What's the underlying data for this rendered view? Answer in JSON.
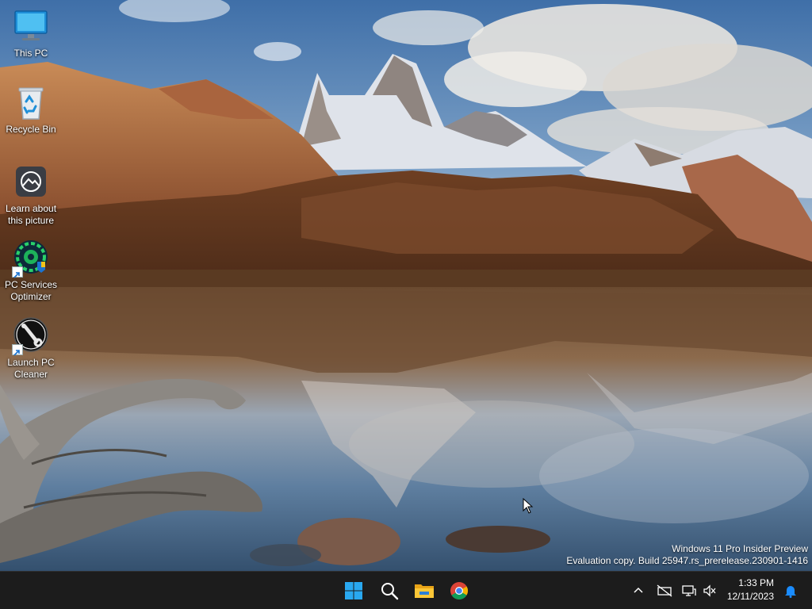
{
  "desktop": {
    "icons": [
      {
        "label": "This PC",
        "icon": "monitor-icon"
      },
      {
        "label": "Recycle Bin",
        "icon": "recycle-bin-icon"
      },
      {
        "label": "Learn about\nthis picture",
        "icon": "camera-icon"
      },
      {
        "label": "PC Services\nOptimizer",
        "icon": "gear-shield-icon"
      },
      {
        "label": "Launch PC\nCleaner",
        "icon": "wrench-icon"
      }
    ]
  },
  "watermark": {
    "line1": "Windows 11 Pro Insider Preview",
    "line2": "Evaluation copy. Build 25947.rs_prerelease.230901-1416"
  },
  "taskbar": {
    "apps": [
      {
        "name": "Start",
        "icon": "windows-logo-icon"
      },
      {
        "name": "Search",
        "icon": "search-icon"
      },
      {
        "name": "File Explorer",
        "icon": "folder-icon"
      },
      {
        "name": "Google Chrome",
        "icon": "chrome-icon"
      }
    ],
    "tray": [
      "chevron-up-icon",
      "network-disconnected-icon",
      "display-icon",
      "volume-muted-icon"
    ],
    "time": "1:33 PM",
    "date": "12/11/2023",
    "notification_icon": "bell-icon"
  },
  "colors": {
    "taskbar_bg": "#1c1c1c",
    "accent": "#0078d4",
    "sky_top": "#3f6fa8"
  }
}
